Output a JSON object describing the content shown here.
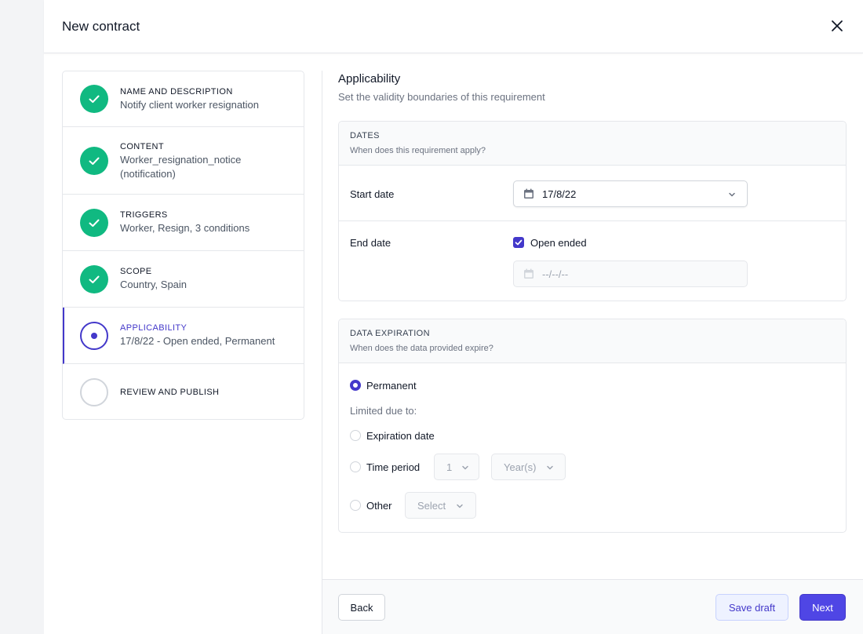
{
  "modal": {
    "title": "New contract"
  },
  "steps": [
    {
      "title": "NAME AND DESCRIPTION",
      "desc": "Notify client worker resignation",
      "status": "done"
    },
    {
      "title": "CONTENT",
      "desc": "Worker_resignation_notice (notification)",
      "status": "done"
    },
    {
      "title": "TRIGGERS",
      "desc": "Worker, Resign, 3 conditions",
      "status": "done"
    },
    {
      "title": "SCOPE",
      "desc": "Country, Spain",
      "status": "done"
    },
    {
      "title": "APPLICABILITY",
      "desc": "17/8/22 - Open ended, Permanent",
      "status": "current"
    },
    {
      "title": "REVIEW AND PUBLISH",
      "desc": "",
      "status": "todo"
    }
  ],
  "content": {
    "title": "Applicability",
    "subtitle": "Set the validity boundaries of this requirement"
  },
  "dates": {
    "title": "DATES",
    "subtitle": "When does this requirement apply?",
    "start_label": "Start date",
    "start_value": "17/8/22",
    "end_label": "End date",
    "open_ended_label": "Open ended",
    "open_ended_checked": true,
    "end_placeholder": "--/--/--"
  },
  "expiration": {
    "title": "DATA EXPIRATION",
    "subtitle": "When does the data provided expire?",
    "permanent_label": "Permanent",
    "limited_label": "Limited due to:",
    "expiration_date_label": "Expiration date",
    "time_period_label": "Time period",
    "time_period_value": "1",
    "time_period_unit": "Year(s)",
    "other_label": "Other",
    "other_placeholder": "Select",
    "selected": "Permanent"
  },
  "footer": {
    "back_label": "Back",
    "save_draft_label": "Save draft",
    "next_label": "Next"
  },
  "colors": {
    "accent": "#4338ca",
    "success": "#10b981"
  }
}
